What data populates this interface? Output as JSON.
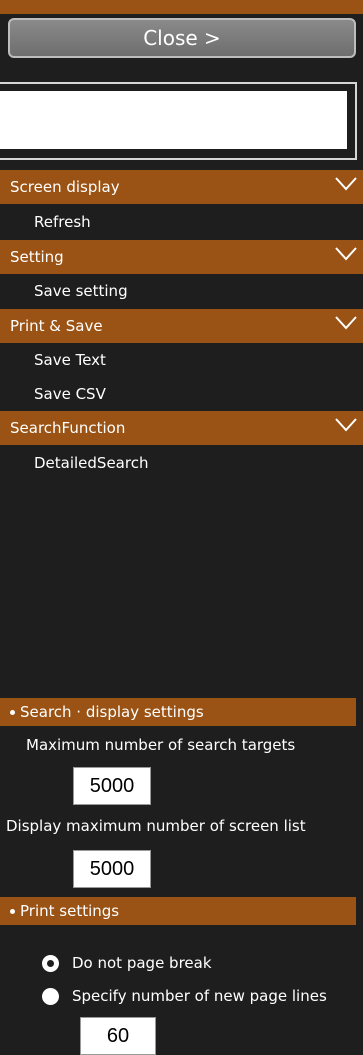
{
  "close_button": {
    "label": "Close >"
  },
  "search": {
    "value": ""
  },
  "menu": {
    "sections": [
      {
        "title": "Screen display",
        "items": [
          "Refresh"
        ]
      },
      {
        "title": "Setting",
        "items": [
          "Save setting"
        ]
      },
      {
        "title": "Print & Save",
        "items": [
          "Save Text",
          "Save CSV"
        ]
      },
      {
        "title": "SearchFunction",
        "items": [
          "DetailedSearch"
        ]
      }
    ]
  },
  "search_display_settings": {
    "header": "Search · display settings",
    "max_search_targets_label": "Maximum number of search targets",
    "max_search_targets_value": "5000",
    "max_screen_list_label": "Display maximum number of screen list",
    "max_screen_list_value": "5000"
  },
  "print_settings": {
    "header": "Print settings",
    "options": [
      "Do not page break",
      "Specify number of new page lines"
    ],
    "selected_index": 0,
    "page_lines_value": "60"
  },
  "colors": {
    "accent": "#9a5314",
    "background": "#1e1e1e",
    "button": "#7a7a7a"
  }
}
